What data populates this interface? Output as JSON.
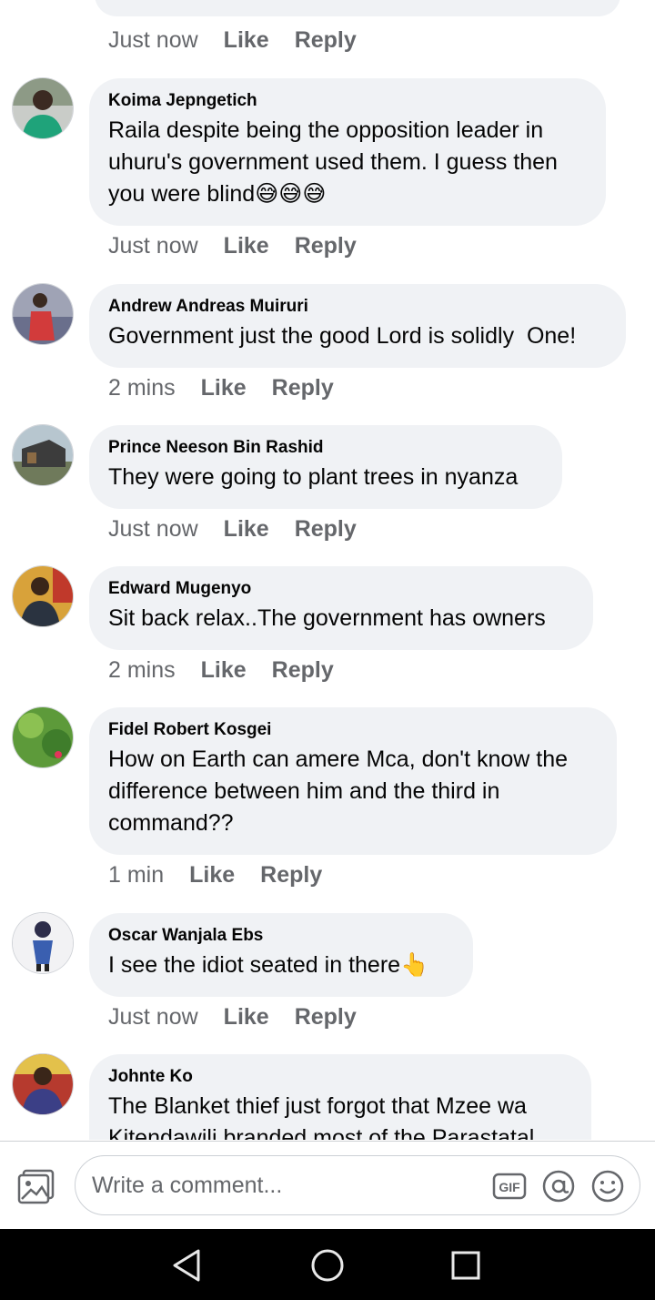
{
  "top_partial": {
    "time": "Just now",
    "like": "Like",
    "reply": "Reply"
  },
  "comments": [
    {
      "author": "Koima Jepngetich",
      "text": "Raila despite being the opposition leader in uhuru's government used them. I guess then you were blind",
      "emoji": "😅😅😅",
      "time": "Just now",
      "like": "Like",
      "reply": "Reply"
    },
    {
      "author": "Andrew Andreas Muiruri",
      "text": "Government just the good Lord is solidly  One!",
      "time": "2 mins",
      "like": "Like",
      "reply": "Reply"
    },
    {
      "author": "Prince Neeson Bin Rashid",
      "text": "They were going to plant trees in nyanza",
      "time": "Just now",
      "like": "Like",
      "reply": "Reply"
    },
    {
      "author": "Edward Mugenyo",
      "text": "Sit back relax..The government has owners",
      "time": "2 mins",
      "like": "Like",
      "reply": "Reply"
    },
    {
      "author": "Fidel Robert Kosgei",
      "text": "How on Earth can amere Mca, don't know the difference between him and the third in command??",
      "time": "1 min",
      "like": "Like",
      "reply": "Reply"
    },
    {
      "author": "Oscar Wanjala Ebs",
      "text": "I see the idiot seated in there",
      "emoji": "👆",
      "time": "Just now",
      "like": "Like",
      "reply": "Reply"
    },
    {
      "author": "Johnte Ko",
      "text": "The Blanket thief just forgot that Mzee wa Kitendawili branded most of the Parastatal"
    }
  ],
  "composer": {
    "placeholder": "Write a comment...",
    "gif_label": "GIF"
  },
  "icons": {
    "photo": "photo-icon",
    "gif": "gif-icon",
    "mention": "at-sign-icon",
    "emoji": "smiley-icon",
    "back": "back-triangle-icon",
    "home": "home-circle-icon",
    "recents": "recents-square-icon"
  },
  "colors": {
    "bubble": "#f0f2f5",
    "meta": "#65676b",
    "text": "#050505",
    "navbar": "#000000"
  }
}
